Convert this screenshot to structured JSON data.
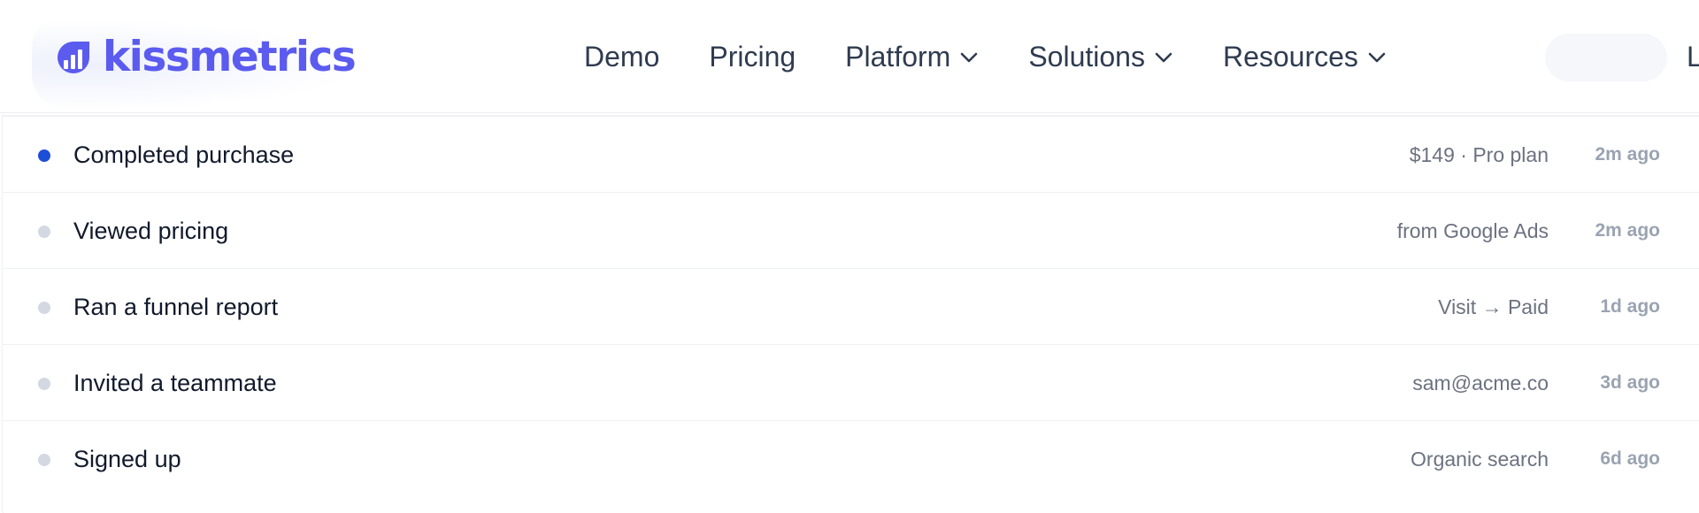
{
  "brand": {
    "name": "kissmetrics",
    "color": "#5b5bf0"
  },
  "nav": {
    "items": [
      {
        "label": "Demo",
        "has_dropdown": false
      },
      {
        "label": "Pricing",
        "has_dropdown": false
      },
      {
        "label": "Platform",
        "has_dropdown": true,
        "icon": "chevron-down-icon"
      },
      {
        "label": "Solutions",
        "has_dropdown": true,
        "icon": "chevron-down-icon"
      },
      {
        "label": "Resources",
        "has_dropdown": true,
        "icon": "chevron-down-icon"
      }
    ],
    "edge_text": "L"
  },
  "activity": {
    "accent_color": "#1d4ed8",
    "rows": [
      {
        "event": "Completed purchase",
        "detail": "$149 · Pro plan",
        "time": "2m ago",
        "active": true
      },
      {
        "event": "Viewed pricing",
        "detail": "from Google Ads",
        "time": "2m ago",
        "active": false
      },
      {
        "event": "Ran a funnel report",
        "detail": "Visit → Paid",
        "time": "1d ago",
        "active": false
      },
      {
        "event": "Invited a teammate",
        "detail": "sam@acme.co",
        "time": "3d ago",
        "active": false
      },
      {
        "event": "Signed up",
        "detail": "Organic search",
        "time": "6d ago",
        "active": false
      }
    ]
  }
}
